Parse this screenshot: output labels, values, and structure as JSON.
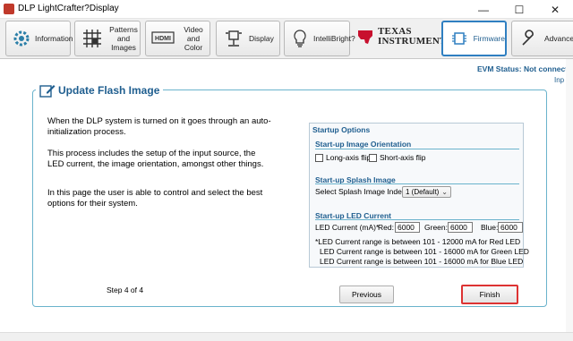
{
  "window": {
    "title": "DLP LightCrafter?Display",
    "min_glyph": "—",
    "max_glyph": "☐",
    "close_glyph": "✕"
  },
  "toolbar": {
    "information": "Information",
    "patterns_images": "Patterns and Images",
    "video_color": "Video and Color",
    "display": "Display",
    "intellibright": "IntelliBright?",
    "ti_line1": "Texas",
    "ti_line2": "Instruments",
    "firmware": "Firmware",
    "advanced": "Advance",
    "hdmi_badge": "HDMI"
  },
  "status": {
    "evm": "EVM Status: Not connect",
    "inp": "Inp"
  },
  "panel": {
    "title": "Update Flash Image",
    "para1": "When the DLP system is turned on it goes through an auto-initialization process.",
    "para2": "This process includes the setup of the input source, the LED current, the image orientation, amongst other things.",
    "para3": "In this page the user is able to control and select the best options for their system.",
    "step": "Step 4 of 4"
  },
  "startup": {
    "header": "Startup Options",
    "orientation_title": "Start-up Image Orientation",
    "long_axis": "Long-axis flip",
    "short_axis": "Short-axis flip",
    "splash_title": "Start-up Splash Image",
    "splash_label": "Select Splash Image Index:",
    "splash_value": "1 (Default)",
    "led_title": "Start-up LED Current",
    "led_label": "LED Current (mA)*",
    "red_label": "Red:",
    "red_value": "6000",
    "green_label": "Green:",
    "green_value": "6000",
    "blue_label": "Blue:",
    "blue_value": "6000",
    "note1": "*LED Current range is between 101 - 12000 mA for Red LED",
    "note2": "LED Current range is between 101 - 16000 mA for Green LED",
    "note3": "LED Current range is between 101 - 16000 mA for Blue LED"
  },
  "buttons": {
    "previous": "Previous",
    "finish": "Finish"
  },
  "colors": {
    "accent": "#1f5e8f",
    "border": "#6ab3cc",
    "finish_outline": "#dd3333"
  }
}
